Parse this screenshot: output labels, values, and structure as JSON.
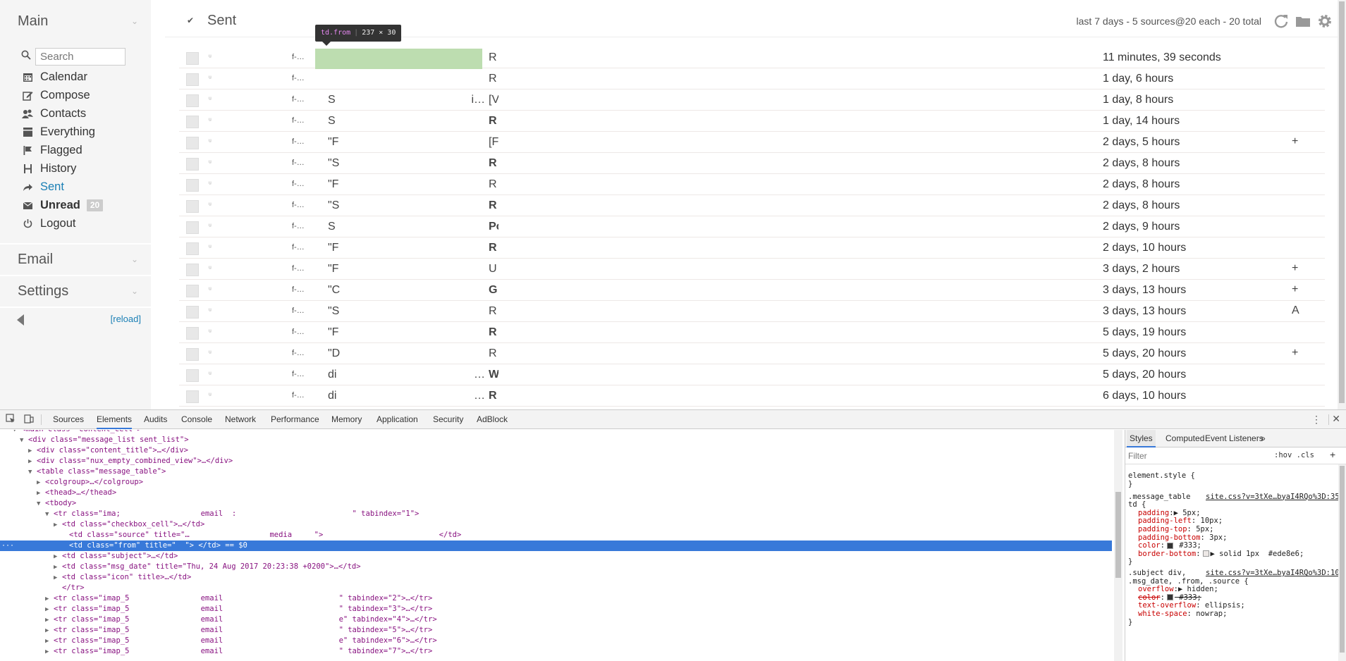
{
  "sidebar": {
    "main_header": "Main",
    "search_placeholder": "Search",
    "items": [
      {
        "label": "Calendar",
        "icon": "calendar-icon"
      },
      {
        "label": "Compose",
        "icon": "compose-icon"
      },
      {
        "label": "Contacts",
        "icon": "contacts-icon"
      },
      {
        "label": "Everything",
        "icon": "inbox-icon"
      },
      {
        "label": "Flagged",
        "icon": "flag-icon"
      },
      {
        "label": "History",
        "icon": "history-icon"
      },
      {
        "label": "Sent",
        "icon": "sent-icon"
      },
      {
        "label": "Unread",
        "icon": "envelope-icon",
        "badge": "20"
      },
      {
        "label": "Logout",
        "icon": "power-icon"
      }
    ],
    "email_header": "Email",
    "settings_header": "Settings",
    "reload_label": "[reload]"
  },
  "content": {
    "title": "Sent",
    "summary": "last 7 days - 5 sources@20 each - 20 total",
    "messages": [
      {
        "from": "",
        "subject": "R",
        "date": "11 minutes, 39 seconds",
        "icon": "",
        "bold": false
      },
      {
        "from": "",
        "subject": "R",
        "date": "1 day, 6 hours",
        "icon": "",
        "bold": false
      },
      {
        "from": "S",
        "from_tail": "i…",
        "subject": "[V",
        "date": "1 day, 8 hours",
        "icon": "",
        "bold": false
      },
      {
        "from": "S",
        "subject": "R",
        "date": "1 day, 14 hours",
        "icon": "",
        "bold": true
      },
      {
        "from": "\"F",
        "subject": "[F",
        "date": "2 days, 5 hours",
        "icon": "+",
        "bold": false
      },
      {
        "from": "\"S",
        "subject": "R",
        "date": "2 days, 8 hours",
        "icon": "",
        "bold": true
      },
      {
        "from": "\"F",
        "subject": "R",
        "date": "2 days, 8 hours",
        "icon": "",
        "bold": false
      },
      {
        "from": "\"S",
        "subject": "R",
        "date": "2 days, 8 hours",
        "icon": "",
        "bold": true
      },
      {
        "from": "S",
        "subject": "Pc",
        "date": "2 days, 9 hours",
        "icon": "",
        "bold": true
      },
      {
        "from": "\"F",
        "subject": "R",
        "date": "2 days, 10 hours",
        "icon": "",
        "bold": true
      },
      {
        "from": "\"F",
        "subject": "U",
        "date": "3 days, 2 hours",
        "icon": "+",
        "bold": false
      },
      {
        "from": "\"C",
        "subject": "G",
        "date": "3 days, 13 hours",
        "icon": "+",
        "bold": true
      },
      {
        "from": "\"S",
        "subject": "R",
        "date": "3 days, 13 hours",
        "icon": "A",
        "bold": false
      },
      {
        "from": "\"F",
        "subject": "R",
        "date": "5 days, 19 hours",
        "icon": "",
        "bold": true
      },
      {
        "from": "\"D",
        "subject": "R",
        "date": "5 days, 20 hours",
        "icon": "+",
        "bold": false
      },
      {
        "from": "di",
        "from_tail": "…",
        "subject": "W",
        "date": "5 days, 20 hours",
        "icon": "",
        "bold": true
      },
      {
        "from": "di",
        "from_tail": "…",
        "subject": "R",
        "date": "6 days, 10 hours",
        "icon": "",
        "bold": true
      }
    ],
    "source_cell_text": "f-…",
    "tooltip": {
      "tag": "td.from",
      "size": "237 × 30"
    }
  },
  "devtools": {
    "tabs": [
      "Sources",
      "Elements",
      "Audits",
      "Console",
      "Network",
      "Performance",
      "Memory",
      "Application",
      "Security",
      "AdBlock"
    ],
    "active_tab": "Elements",
    "dom_lines": [
      {
        "text": "<main class=\"content_cell\">"
      },
      {
        "text": "<div class=\"message_list sent_list\">"
      },
      {
        "text": "<div class=\"content_title\">…</div>"
      },
      {
        "text": "<div class=\"nux_empty_combined_view\">…</div>"
      },
      {
        "text": "<table class=\"message_table\">"
      },
      {
        "text": "<colgroup>…</colgroup>"
      },
      {
        "text": "<thead>…</thead>"
      },
      {
        "text": "<tbody>"
      },
      {
        "text": "<tr class=\"ima;                  email  :                          \" tabindex=\"1\">"
      },
      {
        "text": "<td class=\"checkbox_cell\">…</td>"
      },
      {
        "text": "<td class=\"source\" title=\"…                  media     \">                          </td>"
      },
      {
        "text": "<td class=\"from\" title=\"  \"> </td> == $0"
      },
      {
        "text": "<td class=\"subject\">…</td>"
      },
      {
        "text": "<td class=\"msg_date\" title=\"Thu, 24 Aug 2017 20:23:38 +0200\">…</td>"
      },
      {
        "text": "<td class=\"icon\" title>…</td>"
      },
      {
        "text": "</tr>"
      },
      {
        "text": "<tr class=\"imap_5                email                          \" tabindex=\"2\">…</tr>"
      },
      {
        "text": "<tr class=\"imap_5                email                          \" tabindex=\"3\">…</tr>"
      },
      {
        "text": "<tr class=\"imap_5                email                          e\" tabindex=\"4\">…</tr>"
      },
      {
        "text": "<tr class=\"imap_5                email                          \" tabindex=\"5\">…</tr>"
      },
      {
        "text": "<tr class=\"imap_5                email                          e\" tabindex=\"6\">…</tr>"
      },
      {
        "text": "<tr class=\"imap_5                email                          \" tabindex=\"7\">…</tr>"
      }
    ],
    "styles_tabs": [
      "Styles",
      "Computed",
      "Event Listeners"
    ],
    "filter_placeholder": "Filter",
    "filter_hov": ":hov",
    "filter_cls": ".cls",
    "styles_lines": [
      {
        "kind": "sel",
        "text": "element.style {"
      },
      {
        "kind": "plain",
        "text": "}"
      },
      {
        "kind": "sel",
        "text": ".message_table",
        "link": "site.css?v=3tXe…byaI4RQo%3D:35"
      },
      {
        "kind": "sel",
        "text": "td {"
      },
      {
        "kind": "prop",
        "prop": "padding",
        "val": "▶ 5px;"
      },
      {
        "kind": "prop",
        "prop": "padding-left",
        "val": " 10px;"
      },
      {
        "kind": "prop",
        "prop": "padding-top",
        "val": " 5px;"
      },
      {
        "kind": "prop",
        "prop": "padding-bottom",
        "val": " 3px;"
      },
      {
        "kind": "prop",
        "prop": "color",
        "val": " #333;",
        "swatch": "#333333"
      },
      {
        "kind": "prop",
        "prop": "border-bottom",
        "val": "▶ solid 1px  #ede8e6;",
        "swatch": "#ede8e6"
      },
      {
        "kind": "plain",
        "text": "}"
      },
      {
        "kind": "sel",
        "text": ".subject div,",
        "link": "site.css?v=3tXe…byaI4RQo%3D:10"
      },
      {
        "kind": "sel",
        "text": ".msg_date, .from, .source {"
      },
      {
        "kind": "prop",
        "prop": "overflow",
        "val": "▶ hidden;"
      },
      {
        "kind": "propstrike",
        "prop": "color",
        "val": " #333;",
        "swatch": "#333333"
      },
      {
        "kind": "prop",
        "prop": "text-overflow",
        "val": " ellipsis;"
      },
      {
        "kind": "prop",
        "prop": "white-space",
        "val": " nowrap;"
      },
      {
        "kind": "plain",
        "text": "}"
      }
    ]
  },
  "colors": {
    "accent": "#1a7fb5",
    "highlight": "#b9dbac",
    "devtools_selection": "#3879d9"
  }
}
